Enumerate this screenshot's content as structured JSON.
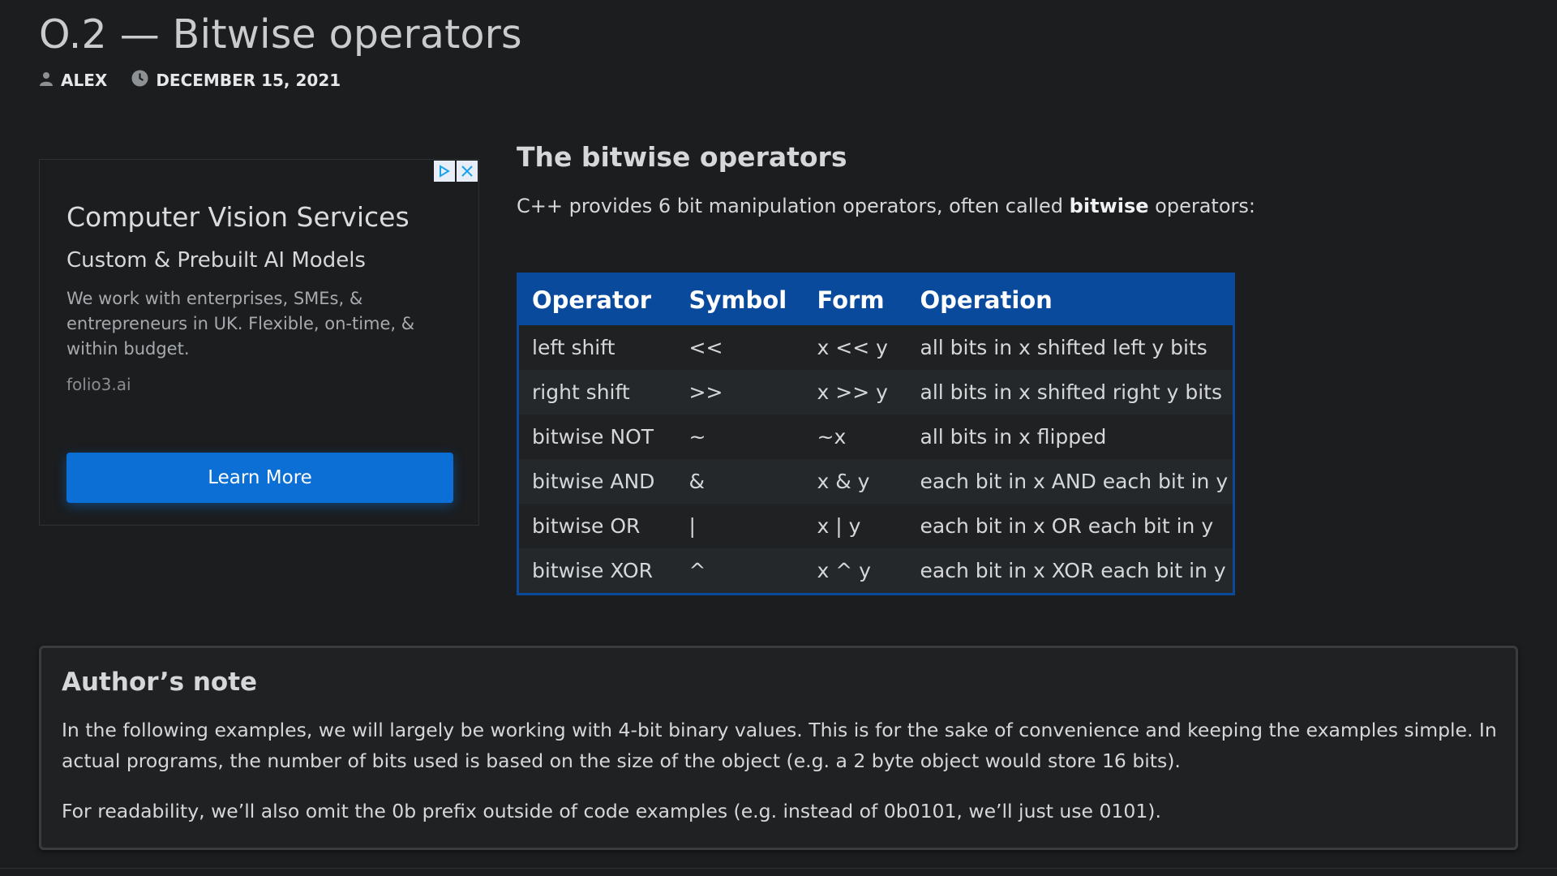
{
  "page": {
    "title": "O.2 — Bitwise operators",
    "author": "ALEX",
    "date": "DECEMBER 15, 2021"
  },
  "icons": {
    "author": "user-icon",
    "date": "clock-icon",
    "ad_choices": "adchoices-icon",
    "ad_close": "close-icon"
  },
  "ad": {
    "headline": "Computer Vision Services",
    "subheadline": "Custom & Prebuilt AI Models",
    "body": "We work with enterprises, SMEs, & entrepreneurs in UK. Flexible, on-time, & within budget.",
    "domain": "folio3.ai",
    "cta_label": "Learn More",
    "cta_color": "#0b6fd6"
  },
  "section": {
    "heading": "The bitwise operators",
    "intro_before": "C++ provides 6 bit manipulation operators, often called ",
    "intro_bold": "bitwise",
    "intro_after": " operators:"
  },
  "table": {
    "header_color": "#0a4a9c",
    "headers": [
      "Operator",
      "Symbol",
      "Form",
      "Operation"
    ],
    "rows": [
      [
        "left shift",
        "<<",
        "x << y",
        "all bits in x shifted left y bits"
      ],
      [
        "right shift",
        ">>",
        "x >> y",
        "all bits in x shifted right y bits"
      ],
      [
        "bitwise NOT",
        "~",
        "~x",
        "all bits in x flipped"
      ],
      [
        "bitwise AND",
        "&",
        "x & y",
        "each bit in x AND each bit in y"
      ],
      [
        "bitwise OR",
        "|",
        "x | y",
        "each bit in x OR each bit in y"
      ],
      [
        "bitwise XOR",
        "^",
        "x ^ y",
        "each bit in x XOR each bit in y"
      ]
    ]
  },
  "note": {
    "title": "Author’s note",
    "p1": "In the following examples, we will largely be working with 4-bit binary values. This is for the sake of convenience and keeping the examples simple. In actual programs, the number of bits used is based on the size of the object (e.g. a 2 byte object would store 16 bits).",
    "p2": "For readability, we’ll also omit the 0b prefix outside of code examples (e.g. instead of 0b0101, we’ll just use 0101)."
  }
}
